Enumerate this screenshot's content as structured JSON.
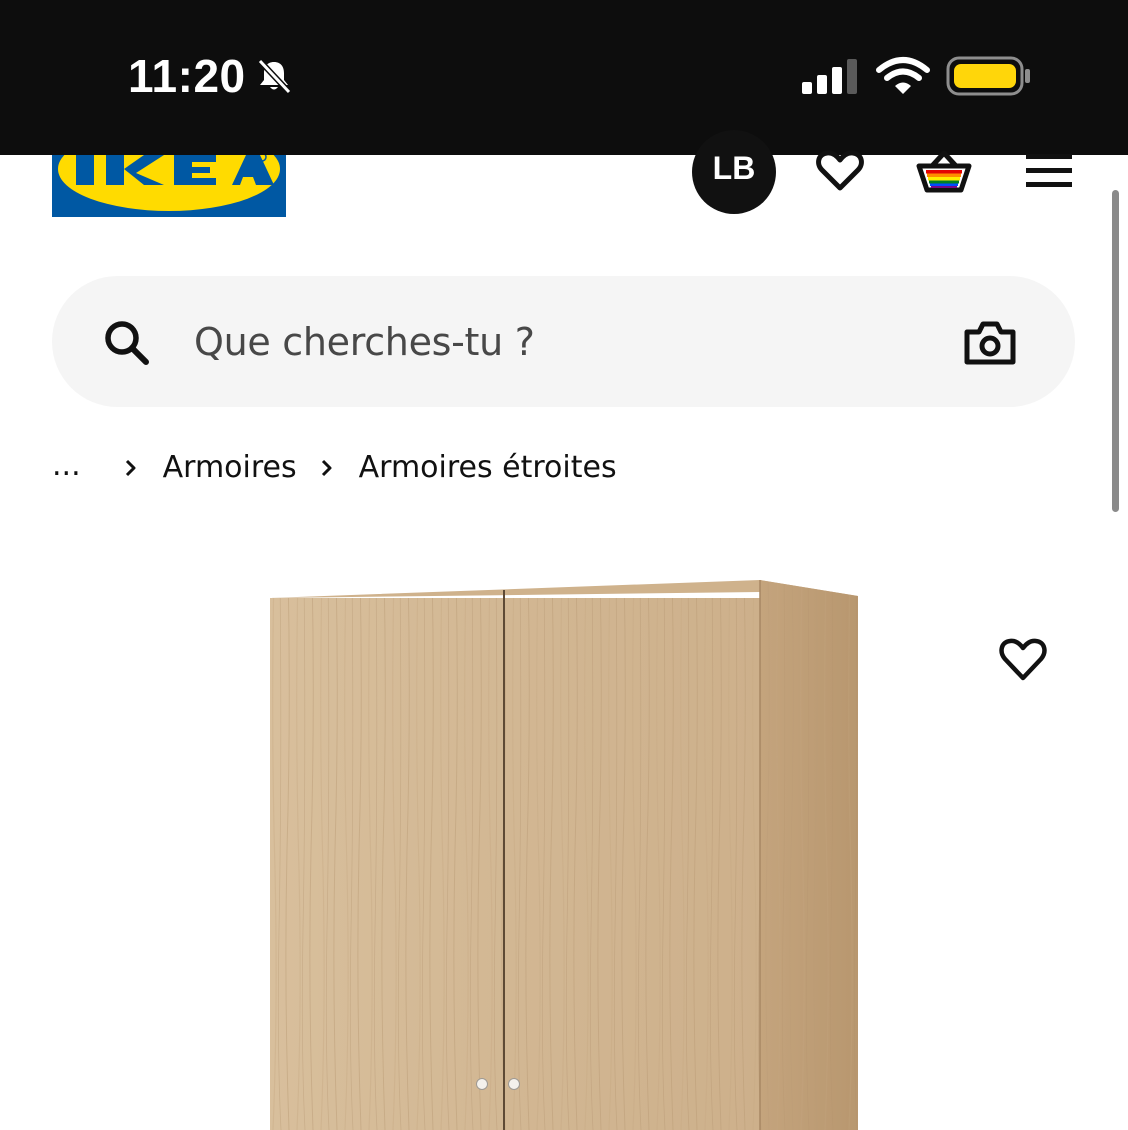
{
  "status_bar": {
    "time": "11:20",
    "icons": [
      "bell-slash-icon",
      "cellular-signal-icon",
      "wifi-icon",
      "battery-icon"
    ],
    "battery_color": "#ffd60a"
  },
  "header": {
    "logo_text": "IKEA",
    "avatar_initials": "LB",
    "icons": [
      "favorites-heart-icon",
      "shopping-basket-icon",
      "menu-icon"
    ]
  },
  "search": {
    "placeholder": "Que cherches-tu ?",
    "icons": [
      "search-icon",
      "camera-icon"
    ]
  },
  "breadcrumb": {
    "items": [
      "...",
      "Armoires",
      "Armoires étroites"
    ]
  },
  "product": {
    "image": "wardrobe-oak-effect",
    "favorite_icon": "heart-outline-icon"
  },
  "colors": {
    "brand_blue": "#0058a3",
    "brand_yellow": "#ffdb00",
    "status_bar_bg": "#0d0d0d",
    "search_bg": "#f5f5f5"
  }
}
